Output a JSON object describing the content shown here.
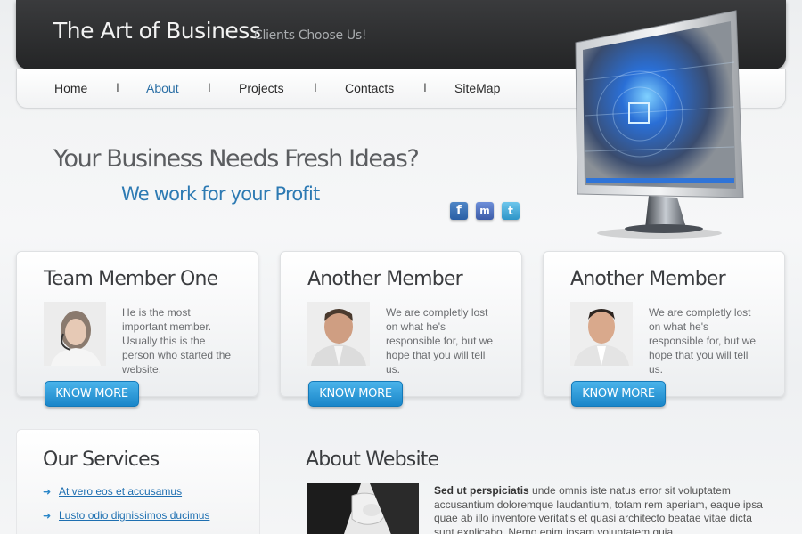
{
  "header": {
    "title": "The Art of Business",
    "tagline": "Clients Choose Us!"
  },
  "nav": {
    "items": [
      "Home",
      "About",
      "Projects",
      "Contacts",
      "SiteMap"
    ],
    "active": "About",
    "separator": "I"
  },
  "hero": {
    "title": "Your Business Needs Fresh Ideas?",
    "subtitle": "We work for your Profit"
  },
  "social": {
    "facebook": "f",
    "messenger": "m",
    "twitter": "t"
  },
  "cards": [
    {
      "title": "Team Member One",
      "text": "He is the most important member. Usually this is the person who started the website.",
      "button": "KNOW MORE"
    },
    {
      "title": "Another Member",
      "text": "We are completly lost on what he's responsible for, but we hope that you will tell us.",
      "button": "KNOW MORE"
    },
    {
      "title": "Another Member",
      "text": "We are completly lost on what he's responsible for, but we hope that you will tell us.",
      "button": "KNOW MORE"
    }
  ],
  "services": {
    "title": "Our Services",
    "links": [
      "At vero eos et accusamus",
      "Lusto odio dignissimos ducimus"
    ]
  },
  "about": {
    "title": "About Website",
    "lead": "Sed ut perspiciatis",
    "text": " unde omnis iste natus error sit voluptatem accusantium doloremque laudantium, totam rem aperiam, eaque ipsa quae ab illo inventore veritatis et quasi architecto beatae vitae dicta sunt explicabo. Nemo enim ipsam voluptatem quia"
  },
  "colors": {
    "header_bg": "#2b2c2e",
    "accent": "#2d7ab3",
    "button": "#1a86c9"
  }
}
